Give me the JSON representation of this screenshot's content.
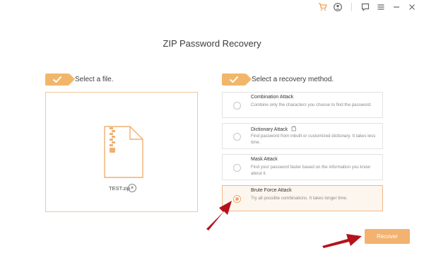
{
  "window": {
    "icons": [
      "cart-icon",
      "account-icon",
      "feedback-icon",
      "menu-icon",
      "minimize-icon",
      "close-icon"
    ]
  },
  "page": {
    "title": "ZIP Password Recovery"
  },
  "file_section": {
    "label": "Select a file.",
    "file_name": "TEST.zip",
    "remove_glyph": "×"
  },
  "method_section": {
    "label": "Select a recovery method.",
    "methods": [
      {
        "title": "Combination Attack",
        "description": "Combine only the characters you choose to find the password.",
        "selected": false
      },
      {
        "title": "Dictionary Attack",
        "description": "Find password from inbuilt or customized dictionary. It takes less time.",
        "selected": false
      },
      {
        "title": "Mask Attack",
        "description": "Find your password faster based on the information you know about it.",
        "selected": false
      },
      {
        "title": "Brute Force Attack",
        "description": "Try all possible combinations. It takes longer time.",
        "selected": true
      }
    ]
  },
  "actions": {
    "recover_label": "Recover"
  },
  "colors": {
    "accent": "#f3b270",
    "annotation_arrow": "#b5121b"
  }
}
